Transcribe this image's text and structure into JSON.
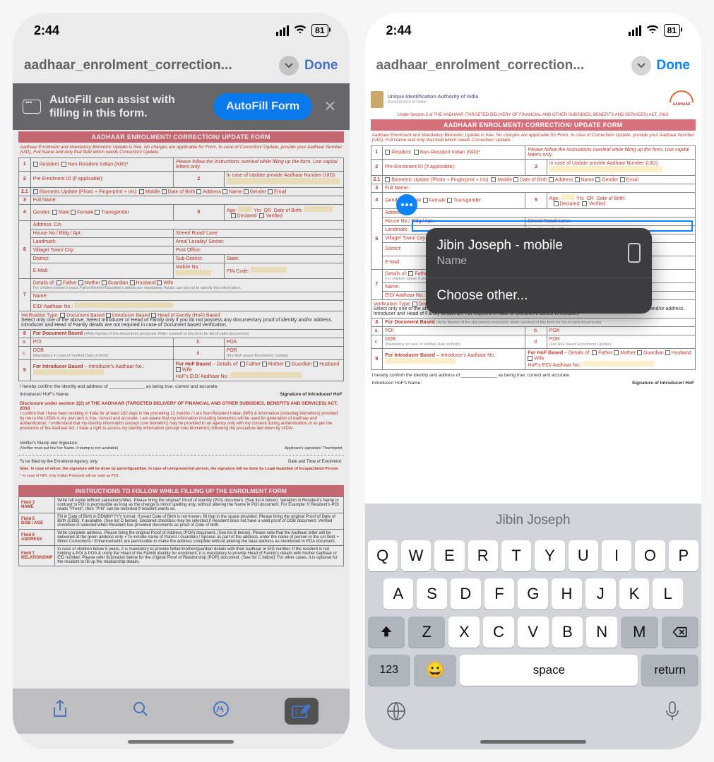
{
  "status": {
    "time": "2:44",
    "battery": "81"
  },
  "nav": {
    "title": "aadhaar_enrolment_correction...",
    "done": "Done"
  },
  "banner": {
    "text": "AutoFill can assist with filling in this form.",
    "button": "AutoFill Form"
  },
  "doc": {
    "authority": "Unique Identification Authority of India",
    "gov": "Government of India",
    "section_note": "Under Section 3 of THE AADHAAR (TARGETED DELIVERY OF FINANCIAL AND OTHER SUBSIDIES, BENEFITS AND SERVICES) ACT, 2016",
    "title": "AADHAAR ENROLMENT/ CORRECTION/ UPDATE FORM",
    "note1": "Aadhaar Enrolment and Mandatory Biometric Update is free. No charges are applicable for Form. In case of Correction/ Update, provide your Aadhaar Number (UID), Full Name and only that field which needs Correction/ Update.",
    "note2": "Please follow the instructions overleaf while filling up the form. Use capital letters only.",
    "rows": {
      "r1a": "Resident",
      "r1b": "Non-Resident Indian (NRI)*",
      "r2a": "Pre Enrolment ID (If applicable):",
      "r2b": "In case of Update provide Aadhaar Number (UID):",
      "r21": "Biometric Update (Photo + Fingerprint + Iris)",
      "m": "Mobile",
      "dob": "Date of Birth",
      "addr": "Address",
      "nm": "Name",
      "gen": "Gender",
      "em": "Email",
      "r3": "Full Name:",
      "r4a": "Gender:",
      "male": "Male",
      "female": "Female",
      "trans": "Transgender",
      "r5a": "Age:",
      "yrs": "Yrs",
      "or": "OR",
      "dob2": "Date of Birth:",
      "decl": "Declared",
      "ver": "Verified",
      "addrco": "Address: C/o",
      "house": "House No./ Bldg./ Apt.:",
      "street": "Street/ Road/ Lane:",
      "land": "Landmark:",
      "area": "Area/ Locality/ Sector:",
      "village": "Village/ Town/ City:",
      "po": "Post Office:",
      "district": "District:",
      "subd": "Sub-District:",
      "state": "State:",
      "email": "E-Mail:",
      "mobno": "Mobile No.:",
      "pin": "PIN Code:",
      "details": "Details of:",
      "father": "Father",
      "mother": "Mother",
      "guardian": "Guardian",
      "husband": "Husband",
      "wife": "Wife",
      "childnote": "For children below 5 years Father/Mother/Guardian's details are mandatory. Adults can opt not to specify this information.",
      "name": "Name:",
      "eid": "EID/ Aadhaar No.:",
      "vtype": "Verification Type:",
      "docb": "Document Based",
      "intb": "Introducer Based",
      "hofb": "Head of Family (HoF) Based",
      "selnote": "Select only one of the above. Select Introducer or Head of Family only if you do not possess any documentary proof of identity and/or address. Introducer and Head of Family details are not required in case of Document based verification.",
      "fordoc": "For Document Based",
      "fordocsub": "(Write Names of the documents produced. Refer overleaf of this form for list of valid documents)",
      "a": "a.",
      "b": "b.",
      "c": "c.",
      "d": "d.",
      "poi": "POI",
      "poa": "POA",
      "dobp": "DOB",
      "por": "POR",
      "mand1": "(Mandatory in case of Verified Date of Birth)",
      "mand2": "(For HoF based Enrolment/ Update)",
      "forint": "For Introducer Based",
      "intlbl": "– Introducer's Aadhaar No.:",
      "forhof": "For HoF Based",
      "hoflbl": "– Details of:",
      "hofeid": "HoF's EID/ Aadhaar No.:",
      "confirm": "I hereby confirm the identity and address of",
      "confirm2": "as being true, correct and accurate.",
      "intname": "Introducer/ HoF's Name:",
      "intsig": "Signature of Introducer/ HoF",
      "disc": "Disclosure under section 3(2) of THE AADHAAR (TARGETED DELIVERY OF FINANCIAL AND OTHER SUBSIDIES, BENEFITS AND SERVICES) ACT, 2016",
      "disctext": "I confirm that I have been residing in India for at least 182 days in the preceding 12 months / I am Non-Resident Indian (NRI) & information (including biometrics) provided by me to the UIDAI is my own and is true, correct and accurate. I am aware that my information including biometrics will be used for generation of Aadhaar and authentication. I understand that my identity information (except core biometric) may be provided to an agency only with my consent during authentication or as per the provisions of the Aadhaar Act. I have a right to access my identity information (except core biometrics) following the procedure laid down by UIDAI.",
      "vstamp": "Verifier's Stamp and Signature:",
      "vnote": "(Verifier must put his/ her Name, if stamp is not available)",
      "appsig": "Applicant's signature/ Thumbprint",
      "agency": "To be filled by the Enrolment Agency only:",
      "dot": "Date and Time of Enrolment:",
      "minor": "Note: In case of minor, the signature will be done by parent/guardian. In case of unrepresented person, the signature will be done by Legal Guardian of Incapacitated Person",
      "nri": "* In case of NRI, only Indian Passport will be valid as POI.",
      "inst_title": "INSTRUCTIONS TO FOLLOW WHILE FILLING UP THE ENROLMENT FORM",
      "f3": "Field 3",
      "f3l": "NAME",
      "f3t": "Write full name without salutations/titles. Please bring the original* Proof of Identity (POI) document. (See list A below). Variation in Resident's Name in contrast to POI is permissible as long as the change is minor spelling only, without altering the Name in POI document. For Example: If Resident's POI reads \"Preeti\", then \"Priti\" can be recorded if resident wants so.",
      "f5": "Field 5",
      "f5l": "DOB / AGE",
      "f5t": "Fill in Date of Birth in DDMMYYYY format. If exact Date of Birth is not known, fill that in the space provided. Please bring the original Proof of Date of Birth (DOB), if available. (See list D below). Declared checkbox may be selected if Resident does not have a valid proof of DOB document. Verified checkbox is selected when Resident has provided documents as proof of Date of birth.",
      "f6": "Field 6",
      "f6l": "ADDRESS",
      "f6t": "Write complete address. Please bring the original Proof of Address (POA) document. (See list B below). Please note that the Aadhaar letter will be delivered at the given address only. • To include name of Parent / Guardian / Spouse as part of the address, enter the name of person in the c/o field. • Minor Corrections / Enhancements are permissible to make the address complete without altering the base address as mentioned in POA document.",
      "f7": "Field 7",
      "f7l": "RELATIONSHIP",
      "f7t": "In case of children below 5 years, it is mandatory to provide father/mother/guardian details with their Aadhaar or EID number. If the resident is not holding a POI & POA & using the Head of the Family identity for enrolment, it is mandatory to provide Head of Family's details with his/her Aadhaar or EID number. Please refer Illustration below for the original Proof of Relationship (POR) document. (See list C below). For other cases, it is optional for the resident to fill up the relationship details."
    }
  },
  "autofill": {
    "option_name": "Jibin Joseph - mobile",
    "option_sub": "Name",
    "other": "Choose other..."
  },
  "keyboard": {
    "suggest": "Jibin Joseph",
    "row1": [
      "Q",
      "W",
      "E",
      "R",
      "T",
      "Y",
      "U",
      "I",
      "O",
      "P"
    ],
    "row2": [
      "A",
      "S",
      "D",
      "F",
      "G",
      "H",
      "J",
      "K",
      "L"
    ],
    "row3": [
      "Z",
      "X",
      "C",
      "V",
      "B",
      "N",
      "M"
    ],
    "num": "123",
    "space": "space",
    "return": "return"
  }
}
